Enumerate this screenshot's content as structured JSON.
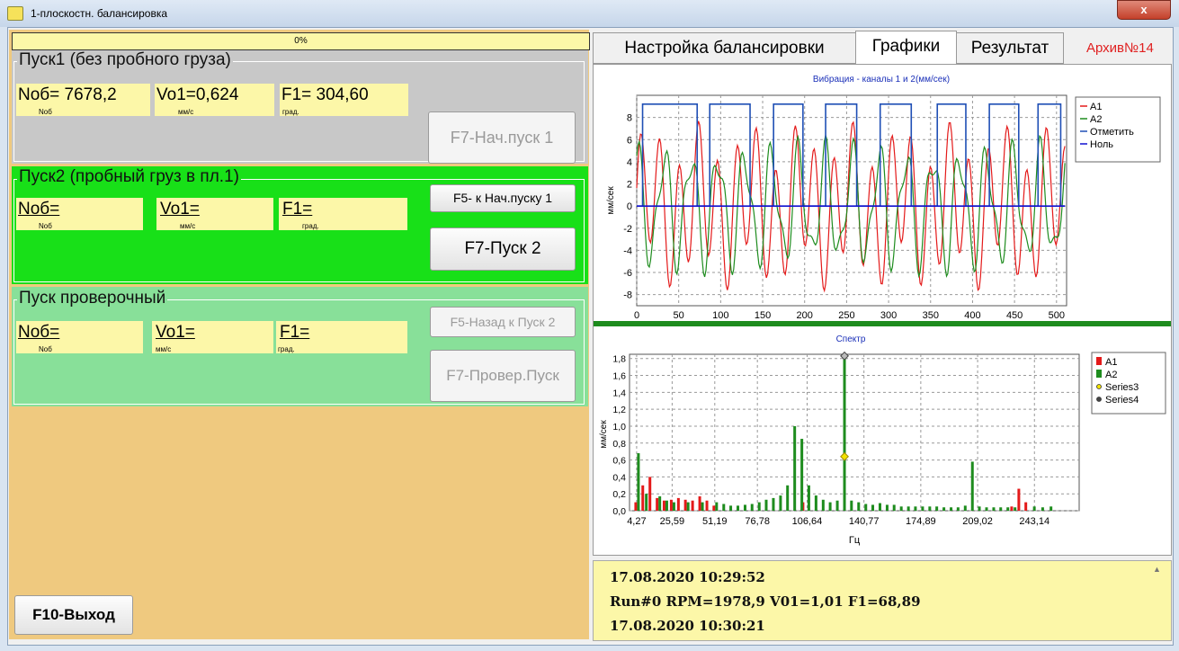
{
  "window": {
    "title": "1-плоскостн. балансировка",
    "close_label": "x"
  },
  "progress": {
    "text": "0%",
    "value": 0
  },
  "run1": {
    "title": "Пуск1 (без пробного груза)",
    "nob": "Nоб= 7678,2",
    "nob_sub": "Nоб",
    "vo": "Vo1=0,624",
    "vo_sub": "мм/с",
    "f": "F1= 304,60",
    "f_sub": "град.",
    "btn_start": "F7-Нач.пуск 1"
  },
  "run2": {
    "title": "Пуск2 (пробный груз в пл.1)",
    "nob": "Nоб=",
    "nob_sub": "Nоб",
    "vo": "Vo1=",
    "vo_sub": "мм/с",
    "f": "F1=",
    "f_sub": "град.",
    "btn_back": "F5- к Нач.пуску 1",
    "btn_start": "F7-Пуск 2"
  },
  "run3": {
    "title": "Пуск проверочный",
    "nob": "Nоб=",
    "nob_sub": "Nоб",
    "vo": "Vo1=",
    "vo_sub": "мм/с",
    "f": "F1=",
    "f_sub": "град.",
    "btn_back": "F5-Назад к Пуск 2",
    "btn_start": "F7-Провер.Пуск"
  },
  "exit_label": "F10-Выход",
  "tabs": [
    "Настройка балансировки",
    "Графики",
    "Результат"
  ],
  "archive": "Архив№14",
  "log": [
    "17.08.2020 10:29:52",
    "Run#0 RPM=1978,9 V01=1,01 F1=68,89",
    "17.08.2020 10:30:21"
  ],
  "colors": {
    "a1": "#e41a1a",
    "a2": "#1e8c1e",
    "mark": "#1f4fb5",
    "zero": "#1010d0",
    "series3": "#f2e200",
    "series4": "#444444"
  },
  "chart_data": [
    {
      "type": "line",
      "title": "Вибрация - каналы 1 и 2(мм/сек)",
      "ylabel": "мм/сек",
      "xlim": [
        0,
        512
      ],
      "ylim": [
        -9,
        10
      ],
      "xticks": [
        "0",
        "50",
        "100",
        "150",
        "200",
        "250",
        "300",
        "350",
        "400",
        "450",
        "500"
      ],
      "yticks": [
        "8",
        "6",
        "4",
        "2",
        "0",
        "-2",
        "-4",
        "-6",
        "-8"
      ],
      "legend_position": "right",
      "series": [
        {
          "name": "A1",
          "params": {
            "amp1": 5.5,
            "per1": 23,
            "amp2": 2.2,
            "per2": 60,
            "phase": 0.3
          }
        },
        {
          "name": "A2",
          "params": {
            "amp1": 4.6,
            "per1": 32,
            "amp2": 1.8,
            "per2": 17,
            "phase": 1.4
          }
        },
        {
          "name": "Отметить",
          "kind": "square",
          "high": 9.2,
          "low": 0,
          "pulses": [
            [
              7,
              72
            ],
            [
              87,
              135
            ],
            [
              163,
              198
            ],
            [
              225,
              262
            ],
            [
              290,
              327
            ],
            [
              358,
              392
            ],
            [
              420,
              455
            ],
            [
              478,
              505
            ]
          ]
        },
        {
          "name": "Ноль",
          "kind": "flat",
          "value": 0
        }
      ]
    },
    {
      "type": "bar",
      "title": "Спектр",
      "ylabel": "мм/сек",
      "xlabel": "Гц",
      "xlim": [
        0,
        270
      ],
      "ylim": [
        0,
        1.85
      ],
      "xticks": [
        "4,27",
        "25,59",
        "51,19",
        "76,78",
        "106,64",
        "140,77",
        "174,89",
        "209,02",
        "243,14"
      ],
      "yticks": [
        "1,8",
        "1,6",
        "1,4",
        "1,2",
        "1,0",
        "0,8",
        "0,6",
        "0,4",
        "0,2",
        "0,0"
      ],
      "legend_position": "right",
      "series": [
        {
          "name": "A1",
          "values": [
            [
              4.27,
              0.1
            ],
            [
              8.5,
              0.3
            ],
            [
              12.8,
              0.4
            ],
            [
              17.1,
              0.15
            ],
            [
              21.3,
              0.12
            ],
            [
              25.6,
              0.13
            ],
            [
              29.9,
              0.15
            ],
            [
              34.1,
              0.13
            ],
            [
              38.4,
              0.12
            ],
            [
              42.7,
              0.17
            ],
            [
              47,
              0.12
            ],
            [
              51.2,
              0.06
            ],
            [
              104.7,
              0.1
            ],
            [
              230,
              0.05
            ],
            [
              234.3,
              0.26
            ],
            [
              238.5,
              0.1
            ]
          ]
        },
        {
          "name": "A2",
          "values": [
            [
              4.27,
              0.68
            ],
            [
              9,
              0.2
            ],
            [
              17.1,
              0.17
            ],
            [
              21.3,
              0.12
            ],
            [
              25.6,
              0.1
            ],
            [
              34.1,
              0.1
            ],
            [
              42.7,
              0.1
            ],
            [
              51.2,
              0.1
            ],
            [
              55.5,
              0.08
            ],
            [
              59.7,
              0.06
            ],
            [
              64,
              0.06
            ],
            [
              68.3,
              0.07
            ],
            [
              72.5,
              0.08
            ],
            [
              76.8,
              0.1
            ],
            [
              81,
              0.13
            ],
            [
              85.3,
              0.15
            ],
            [
              89.6,
              0.18
            ],
            [
              93.8,
              0.3
            ],
            [
              98.1,
              1.0
            ],
            [
              102.4,
              0.85
            ],
            [
              106.6,
              0.3
            ],
            [
              110.9,
              0.18
            ],
            [
              115.2,
              0.13
            ],
            [
              119.4,
              0.1
            ],
            [
              123.7,
              0.12
            ],
            [
              128,
              1.82
            ],
            [
              132.2,
              0.12
            ],
            [
              136.5,
              0.1
            ],
            [
              140.8,
              0.08
            ],
            [
              145,
              0.07
            ],
            [
              149.3,
              0.09
            ],
            [
              153.6,
              0.07
            ],
            [
              157.8,
              0.07
            ],
            [
              162.1,
              0.05
            ],
            [
              166.4,
              0.05
            ],
            [
              170.6,
              0.05
            ],
            [
              174.9,
              0.05
            ],
            [
              179.2,
              0.05
            ],
            [
              183.4,
              0.05
            ],
            [
              187.7,
              0.04
            ],
            [
              192,
              0.04
            ],
            [
              196.2,
              0.04
            ],
            [
              200.5,
              0.06
            ],
            [
              204.8,
              0.58
            ],
            [
              209,
              0.05
            ],
            [
              213.3,
              0.04
            ],
            [
              217.6,
              0.04
            ],
            [
              221.8,
              0.04
            ],
            [
              226.1,
              0.04
            ],
            [
              230.4,
              0.04
            ],
            [
              242,
              0.05
            ],
            [
              247,
              0.04
            ],
            [
              252,
              0.05
            ]
          ]
        },
        {
          "name": "Series3",
          "values": [
            [
              128,
              0.63
            ]
          ]
        },
        {
          "name": "Series4",
          "values": [
            [
              128,
              1.82
            ]
          ]
        }
      ]
    }
  ]
}
